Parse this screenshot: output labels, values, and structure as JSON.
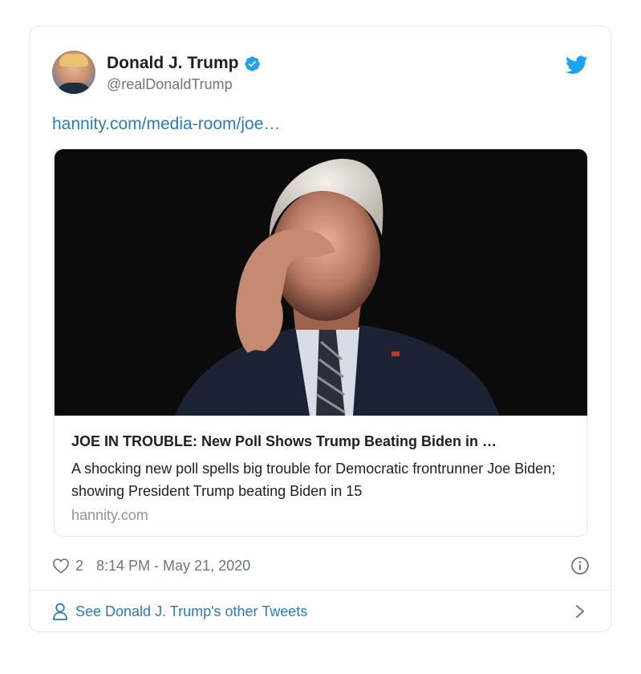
{
  "tweet": {
    "author_name": "Donald J. Trump",
    "handle": "@realDonaldTrump",
    "link_text": "hannity.com/media-room/joe…",
    "likes": "2",
    "timestamp": "8:14 PM - May 21, 2020"
  },
  "card": {
    "title": "JOE IN TROUBLE: New Poll Shows Trump Beating Biden in …",
    "description": "A shocking new poll spells big trouble for Democratic frontrunner Joe Biden; showing President Trump beating Biden in 15",
    "domain": "hannity.com"
  },
  "footer": {
    "other_tweets": "See Donald J. Trump's other Tweets"
  },
  "icons": {
    "verified": "verified-badge-icon",
    "brand": "twitter-bird-icon",
    "like": "heart-icon",
    "info": "info-icon",
    "profile": "person-icon",
    "chevron": "chevron-right-icon"
  },
  "colors": {
    "accent": "#1da1f2",
    "link": "#2b7bb9",
    "muted": "#697882",
    "border": "#e1e8ed"
  }
}
